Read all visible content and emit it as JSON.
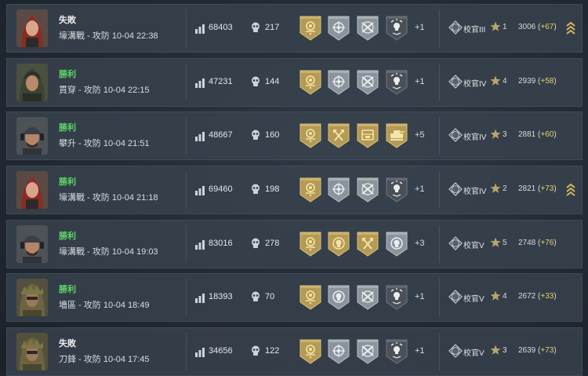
{
  "matches": [
    {
      "result": "失敗",
      "result_type": "loss",
      "mode": "壕溝戰 - 攻防 10-04 22:38",
      "avatar": "red-hair-female",
      "score": "68403",
      "kills": "217",
      "medals": [
        "gold-skull-flower",
        "silver-crosshair",
        "silver-crossed-rifles",
        "dark-skull-badge"
      ],
      "extra": "+1",
      "rank_name": "校官III",
      "rank_numeral": "III",
      "tier": "1",
      "rating": "3006",
      "delta": "+67",
      "promo": true
    },
    {
      "result": "勝利",
      "result_type": "win",
      "mode": "貫穿 - 攻防 10-04 22:15",
      "avatar": "hooded-soldier",
      "score": "47231",
      "kills": "144",
      "medals": [
        "gold-skull-flower",
        "silver-crosshair",
        "silver-crossed-rifles",
        "dark-skull-badge"
      ],
      "extra": "+1",
      "rank_name": "校官IV",
      "rank_numeral": "IV",
      "tier": "4",
      "rating": "2939",
      "delta": "+58",
      "promo": false
    },
    {
      "result": "勝利",
      "result_type": "win",
      "mode": "攀升 - 攻防 10-04 21:51",
      "avatar": "cap-headset-male",
      "score": "48667",
      "kills": "160",
      "medals": [
        "gold-skull-flower",
        "gold-crossed-axes",
        "gold-objective-box",
        "gold-tank"
      ],
      "extra": "+5",
      "rank_name": "校官IV",
      "rank_numeral": "IV",
      "tier": "3",
      "rating": "2881",
      "delta": "+60",
      "promo": false
    },
    {
      "result": "勝利",
      "result_type": "win",
      "mode": "壕溝戰 - 攻防 10-04 21:18",
      "avatar": "red-hair-female",
      "score": "69460",
      "kills": "198",
      "medals": [
        "gold-skull-flower",
        "silver-crosshair",
        "silver-crossed-rifles",
        "dark-skull-badge"
      ],
      "extra": "+1",
      "rank_name": "校官IV",
      "rank_numeral": "IV",
      "tier": "2",
      "rating": "2821",
      "delta": "+73",
      "promo": true
    },
    {
      "result": "勝利",
      "result_type": "win",
      "mode": "壕溝戰 - 攻防 10-04 19:03",
      "avatar": "cap-headset-male",
      "score": "83016",
      "kills": "278",
      "medals": [
        "gold-skull-flower",
        "gold-skull-ring",
        "gold-crossed-axes",
        "silver-skull-ring"
      ],
      "extra": "+3",
      "rank_name": "校官V",
      "rank_numeral": "V",
      "tier": "5",
      "rating": "2748",
      "delta": "+76",
      "promo": false
    },
    {
      "result": "勝利",
      "result_type": "win",
      "mode": "墻區 - 攻防 10-04 18:49",
      "avatar": "ghillie-soldier",
      "score": "18393",
      "kills": "70",
      "medals": [
        "gold-skull-flower",
        "silver-skull-ring",
        "silver-crossed-rifles",
        "dark-skull-badge"
      ],
      "extra": "+1",
      "rank_name": "校官V",
      "rank_numeral": "V",
      "tier": "4",
      "rating": "2672",
      "delta": "+33",
      "promo": false
    },
    {
      "result": "失敗",
      "result_type": "loss",
      "mode": "刀鋒 - 攻防 10-04 17:45",
      "avatar": "ghillie-soldier",
      "score": "34656",
      "kills": "122",
      "medals": [
        "gold-skull-flower",
        "silver-crosshair",
        "silver-crossed-rifles",
        "dark-skull-badge"
      ],
      "extra": "+1",
      "rank_name": "校官V",
      "rank_numeral": "V",
      "tier": "3",
      "rating": "2639",
      "delta": "+73",
      "promo": false
    }
  ],
  "colors": {
    "win": "#5fd36a",
    "gold_accent": "#e9cf62",
    "medal_gold": "#b49a55",
    "medal_silver": "#8b949c",
    "medal_dark": "#4a5058"
  }
}
